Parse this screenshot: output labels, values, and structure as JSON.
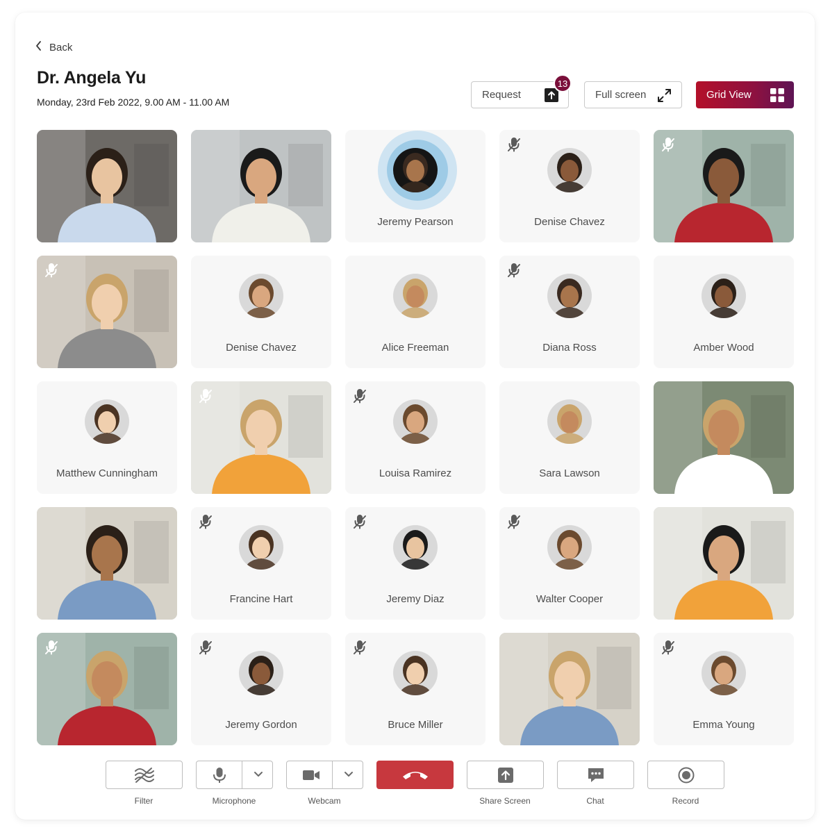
{
  "header": {
    "back_label": "Back",
    "doctor_name": "Dr. Angela Yu",
    "session_datetime": "Monday, 23rd Feb 2022, 9.00 AM - 11.00 AM",
    "request_label": "Request",
    "request_count": "13",
    "fullscreen_label": "Full screen",
    "gridview_label": "Grid View"
  },
  "participants": [
    {
      "name": "",
      "video": true,
      "muted": false
    },
    {
      "name": "",
      "video": true,
      "muted": false
    },
    {
      "name": "Jeremy Pearson",
      "video": false,
      "muted": false,
      "speaking": true
    },
    {
      "name": "Denise Chavez",
      "video": false,
      "muted": true
    },
    {
      "name": "",
      "video": true,
      "muted": true
    },
    {
      "name": "",
      "video": true,
      "muted": true
    },
    {
      "name": "Denise Chavez",
      "video": false,
      "muted": false
    },
    {
      "name": "Alice Freeman",
      "video": false,
      "muted": false
    },
    {
      "name": "Diana Ross",
      "video": false,
      "muted": true
    },
    {
      "name": "Amber Wood",
      "video": false,
      "muted": false
    },
    {
      "name": "Matthew Cunningham",
      "video": false,
      "muted": false
    },
    {
      "name": "",
      "video": true,
      "muted": true
    },
    {
      "name": "Louisa Ramirez",
      "video": false,
      "muted": true
    },
    {
      "name": "Sara Lawson",
      "video": false,
      "muted": false
    },
    {
      "name": "",
      "video": true,
      "muted": false
    },
    {
      "name": "",
      "video": true,
      "muted": false
    },
    {
      "name": "Francine Hart",
      "video": false,
      "muted": true
    },
    {
      "name": "Jeremy Diaz",
      "video": false,
      "muted": true
    },
    {
      "name": "Walter Cooper",
      "video": false,
      "muted": true
    },
    {
      "name": "",
      "video": true,
      "muted": false
    },
    {
      "name": "",
      "video": true,
      "muted": true
    },
    {
      "name": "Jeremy Gordon",
      "video": false,
      "muted": true
    },
    {
      "name": "Bruce Miller",
      "video": false,
      "muted": true
    },
    {
      "name": "",
      "video": true,
      "muted": false
    },
    {
      "name": "Emma Young",
      "video": false,
      "muted": true
    }
  ],
  "controls": {
    "filter_label": "Filter",
    "microphone_label": "Microphone",
    "webcam_label": "Webcam",
    "share_label": "Share Screen",
    "chat_label": "Chat",
    "record_label": "Record"
  },
  "colors": {
    "accent_start": "#b3102a",
    "accent_end": "#5e1454",
    "badge": "#7a0f3a",
    "hangup": "#c7383e",
    "speaking_ring": "#cfe4f2"
  }
}
